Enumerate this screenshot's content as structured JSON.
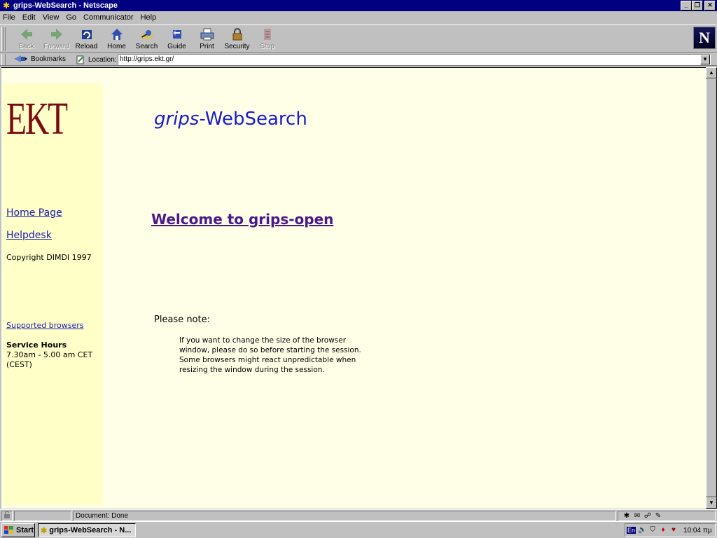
{
  "window": {
    "title": "grips-WebSearch - Netscape"
  },
  "menu": [
    "File",
    "Edit",
    "View",
    "Go",
    "Communicator",
    "Help"
  ],
  "toolbar": {
    "back": "Back",
    "forward": "Forward",
    "reload": "Reload",
    "home": "Home",
    "search": "Search",
    "guide": "Guide",
    "print": "Print",
    "security": "Security",
    "stop": "Stop"
  },
  "location": {
    "bookmarks": "Bookmarks",
    "label": "Location:",
    "url": "http://grips.ekt.gr/"
  },
  "sidebar": {
    "logo": "EKT",
    "home_link": "Home Page",
    "helpdesk_link": "Helpdesk",
    "copyright": "Copyright DIMDI 1997",
    "browsers_link": "Supported browsers",
    "hours_title": "Service Hours",
    "hours_line1": "7.30am - 5.00 am CET",
    "hours_line2": "(CEST)"
  },
  "main": {
    "title_italic": "grips",
    "title_rest": "-WebSearch",
    "welcome": "Welcome to grips-open",
    "note_heading": "Please note:",
    "note_lines": [
      "If you want to change the size of the browser",
      "window, please do so before starting the session.",
      "Some browsers might react unpredictable when",
      "resizing the window during the session."
    ]
  },
  "status": {
    "text": "Document: Done"
  },
  "taskbar": {
    "start": "Start",
    "task": "grips-WebSearch - N...",
    "lang": "En",
    "clock": "10:04 πμ"
  }
}
